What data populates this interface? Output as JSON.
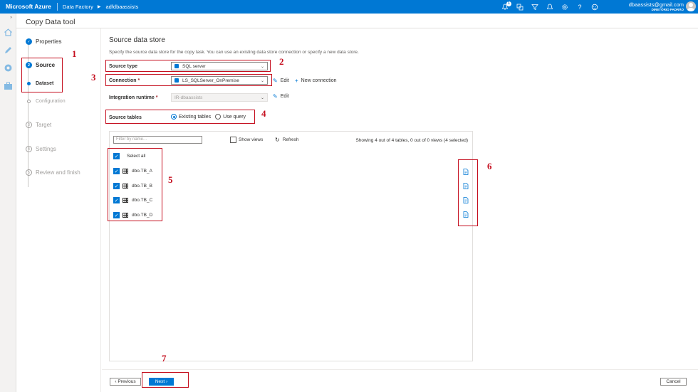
{
  "topbar": {
    "brand": "Microsoft Azure",
    "breadcrumb": [
      "Data Factory",
      "adfdbaassists"
    ],
    "notification_count": "1",
    "user_name": "dbaassists@gmail.com",
    "user_directory": "DIRETÓRIO PADRÃO"
  },
  "tool_title": "Copy Data tool",
  "steps": [
    {
      "label": "Properties",
      "num": "✓",
      "state": "done"
    },
    {
      "label": "Source",
      "num": "2",
      "state": "active"
    },
    {
      "label": "Dataset",
      "state": "sub-active"
    },
    {
      "label": "Configuration",
      "state": "sub-inactive"
    },
    {
      "label": "Target",
      "num": "3",
      "state": "pending"
    },
    {
      "label": "Settings",
      "num": "4",
      "state": "pending"
    },
    {
      "label": "Review and finish",
      "num": "5",
      "state": "pending"
    }
  ],
  "main": {
    "section_title": "Source data store",
    "description": "Specify the source data store for the copy task. You can use an existing data store connection or specify a new data store.",
    "source_type_label": "Source type",
    "source_type_value": "SQL server",
    "connection_label": "Connection",
    "connection_value": "LS_SQLServer_OnPremise",
    "edit_label": "Edit",
    "new_connection_label": "New connection",
    "integration_runtime_label": "Integration runtime",
    "integration_runtime_value": "IR-dbaassists",
    "source_tables_label": "Source tables",
    "radio_existing": "Existing tables",
    "radio_query": "Use query",
    "filter_placeholder": "Filter by name...",
    "show_views_label": "Show views",
    "refresh_label": "Refresh",
    "count_text": "Showing 4 out of 4 tables, 0 out of 0 views (4 selected)",
    "select_all_label": "Select all",
    "tables": [
      "dbo.TB_A",
      "dbo.TB_B",
      "dbo.TB_C",
      "dbo.TB_D"
    ]
  },
  "footer": {
    "previous_label": "‹ Previous",
    "next_label": "Next ›",
    "cancel_label": "Cancel"
  },
  "annotations": [
    "1",
    "2",
    "3",
    "4",
    "5",
    "6",
    "7"
  ],
  "colors": {
    "accent": "#0078d4",
    "annotation": "#c50f1f"
  }
}
